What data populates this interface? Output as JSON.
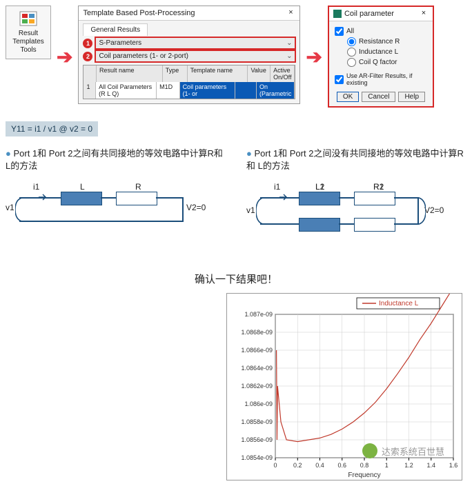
{
  "toolbar_btn": {
    "label": "Result Templates Tools"
  },
  "template_dialog": {
    "title": "Template Based Post-Processing",
    "tab": "General Results",
    "badges": [
      "1",
      "2"
    ],
    "combo1": "S-Parameters",
    "combo2": "Coil parameters (1- or 2-port)",
    "headers": {
      "name": "Result name",
      "type": "Type",
      "tpl": "Template name",
      "val": "Value",
      "act": "Active On/Off"
    },
    "row": {
      "num": "1",
      "name": "All Coil Parameters (R L Q)",
      "type": "M1D",
      "tpl": "Coil parameters (1- or",
      "val": "",
      "act": "On (Parametric"
    }
  },
  "coil_dialog": {
    "title": "Coil parameter",
    "all": "All",
    "opts": {
      "r": "Resistance R",
      "l": "Inductance L",
      "q": "Coil Q factor"
    },
    "ar": "Use AR-Filter Results, if existing",
    "btns": {
      "ok": "OK",
      "cancel": "Cancel",
      "help": "Help"
    }
  },
  "formula": "Y11 = i1 / v1 @ v2 = 0",
  "left_text": "Port 1和 Port 2之间有共同接地的等效电路中计算R和 L的方法",
  "right_text": "Port 1和 Port 2之间没有共同接地的等效电路中计算R和 L的方法",
  "circuit1": {
    "i1": "i1",
    "v1": "v1",
    "L": "L",
    "R": "R",
    "V2": "V2=0"
  },
  "circuit2": {
    "i1": "i1",
    "v1": "v1",
    "L1": "L1",
    "R1": "R1",
    "L2": "L2",
    "R2": "R2",
    "V2": "V2=0"
  },
  "confirm": "确认一下结果吧！",
  "chart": {
    "legend": "Inductance L",
    "xlabel": "Frequency",
    "yTicks": [
      "1.087e-09",
      "1.0868e-09",
      "1.0866e-09",
      "1.0864e-09",
      "1.0862e-09",
      "1.086e-09",
      "1.0858e-09",
      "1.0856e-09",
      "1.0854e-09"
    ],
    "xTicks": [
      "0",
      "0.2",
      "0.4",
      "0.6",
      "0.8",
      "1",
      "1.2",
      "1.4",
      "1.6"
    ]
  },
  "chart_data": {
    "type": "line",
    "title": "",
    "xlabel": "Frequency",
    "ylabel": "",
    "xlim": [
      0,
      1.6
    ],
    "ylim": [
      1.0854e-09,
      1.087e-09
    ],
    "series": [
      {
        "name": "Inductance L",
        "x": [
          0.02,
          0.05,
          0.1,
          0.2,
          0.3,
          0.4,
          0.5,
          0.6,
          0.7,
          0.8,
          0.9,
          1.0,
          1.1,
          1.2,
          1.3,
          1.4,
          1.5,
          1.6
        ],
        "y": [
          1.0862e-09,
          1.0858e-09,
          1.0856e-09,
          1.08558e-09,
          1.0856e-09,
          1.08562e-09,
          1.08566e-09,
          1.08572e-09,
          1.0858e-09,
          1.0859e-09,
          1.08602e-09,
          1.08617e-09,
          1.08634e-09,
          1.08652e-09,
          1.08672e-09,
          1.0869e-09,
          1.0871e-09,
          1.0873e-09
        ]
      }
    ]
  },
  "watermark": "达索系统百世慧"
}
